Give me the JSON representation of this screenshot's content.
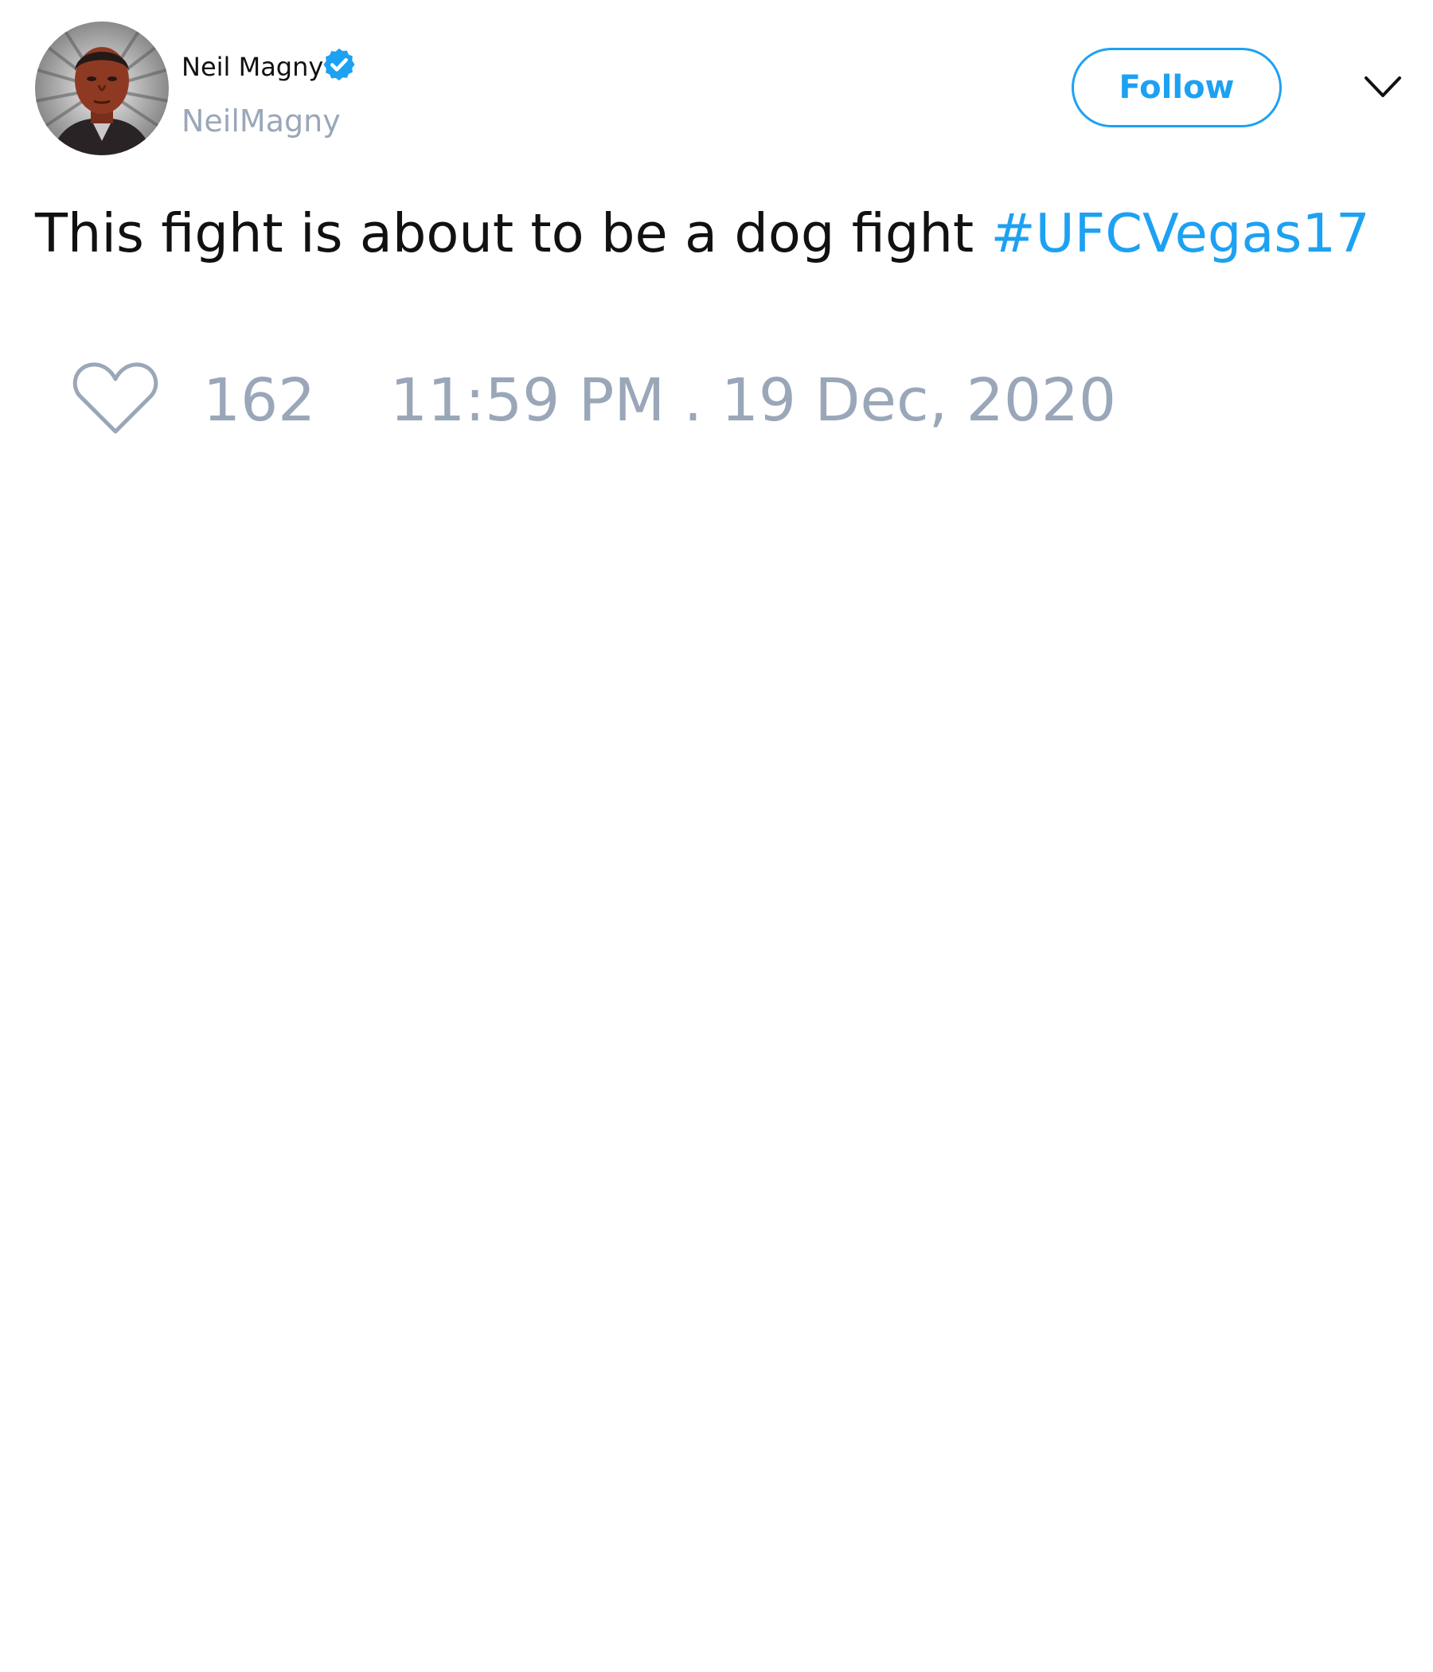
{
  "tweet": {
    "author": {
      "display_name": "Neil Magny",
      "handle": "NeilMagny",
      "verified": true,
      "avatar_icon": "user-avatar-photo"
    },
    "follow_label": "Follow",
    "menu_icon": "chevron-down-icon",
    "text": "This fight is about to be a dog fight ",
    "hashtag": "#UFCVegas17",
    "like_count": "162",
    "timestamp": "11:59 PM . 19 Dec, 2020"
  },
  "colors": {
    "accent": "#1da1f2",
    "muted": "#9aa7b9",
    "text": "#111111",
    "background": "#ffffff"
  }
}
